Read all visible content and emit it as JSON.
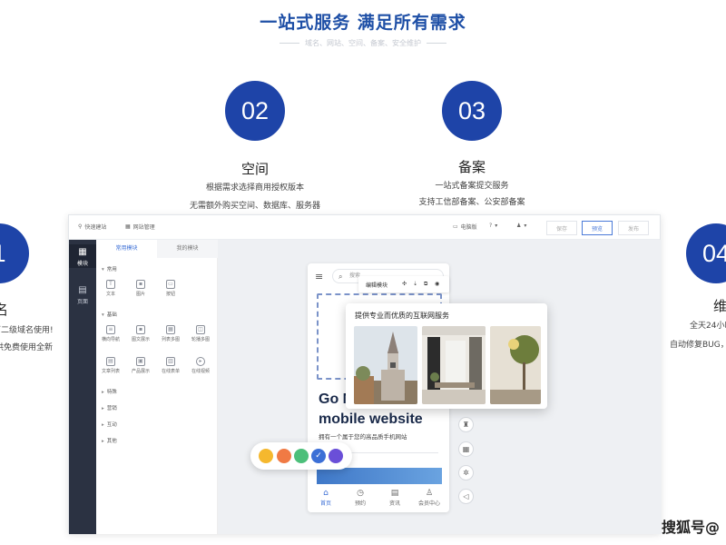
{
  "header": {
    "title": "一站式服务  满足所有需求",
    "subtitle": "域名、网站、空间、备案、安全维护"
  },
  "steps": [
    {
      "num": "1",
      "title": "名",
      "desc": [
        "下二级域名使用!",
        "提供免费使用全新"
      ]
    },
    {
      "num": "02",
      "title": "空间",
      "desc": [
        "根据需求选择商用授权版本",
        "无需额外购买空间、数据库、服务器"
      ]
    },
    {
      "num": "03",
      "title": "备案",
      "desc": [
        "一站式备案提交服务",
        "支持工信部备案、公安部备案"
      ]
    },
    {
      "num": "04",
      "title": "维",
      "desc": [
        "全天24小时",
        "自动修复BUG，"
      ]
    }
  ],
  "builder": {
    "topbar": {
      "quick_start": "快速建站",
      "site_manage": "网站管理",
      "device": "电脑版",
      "help": "?",
      "user": "",
      "save_button": "保存",
      "preview_button": "预览",
      "publish_button": "发布"
    },
    "leftbar": [
      {
        "icon": "grid-icon",
        "label": "模块"
      },
      {
        "icon": "page-icon",
        "label": "页面"
      }
    ],
    "panel": {
      "tabs": [
        "常用模块",
        "我的模块"
      ],
      "categories": [
        {
          "name": "常用",
          "widgets": [
            "文本",
            "图片",
            "按钮"
          ]
        },
        {
          "name": "基础",
          "widgets": [
            "横向导航",
            "图文展示",
            "列表多图",
            "轮播多图",
            "文章列表",
            "产品展示",
            "在线表单",
            "在线视频"
          ]
        },
        {
          "name": "特殊"
        },
        {
          "name": "营销"
        },
        {
          "name": "互动"
        },
        {
          "name": "其他"
        }
      ]
    },
    "phone": {
      "search_placeholder": "搜索",
      "float_label": "编辑模块",
      "headline": "Go M",
      "headline2": "mobile website",
      "subline": "拥有一个属于您的高品质手机网站",
      "nav": [
        "首页",
        "预约",
        "资讯",
        "会员中心"
      ]
    },
    "popup": {
      "title": "提供专业而优质的互联网服务"
    },
    "palette": {
      "colors": [
        "#f5b82e",
        "#f07a44",
        "#4cbf7a",
        "#3c6fd6",
        "#6a4fd8"
      ],
      "selected_index": 3
    }
  },
  "watermark": "搜狐号@"
}
